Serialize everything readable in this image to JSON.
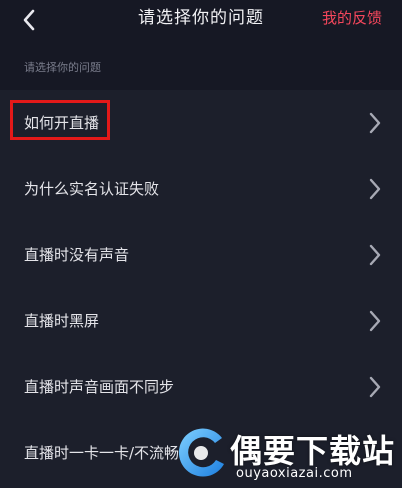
{
  "header": {
    "back_icon": "chevron-left-icon",
    "title": "请选择你的问题",
    "feedback_label": "我的反馈"
  },
  "section": {
    "label": "请选择你的问题"
  },
  "items": [
    {
      "label": "如何开直播"
    },
    {
      "label": "为什么实名认证失败"
    },
    {
      "label": "直播时没有声音"
    },
    {
      "label": "直播时黑屏"
    },
    {
      "label": "直播时声音画面不同步"
    },
    {
      "label": "直播时一卡一卡/不流畅"
    }
  ],
  "watermark": {
    "title": "偶要下载站",
    "url": "ouyaoxiazai.com"
  },
  "colors": {
    "background": "#161824",
    "list_background": "#1c1f2b",
    "accent": "#f5475c",
    "highlight": "#e31919"
  }
}
